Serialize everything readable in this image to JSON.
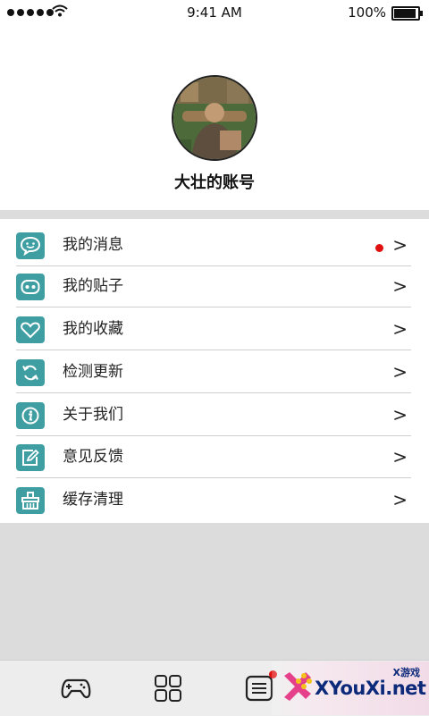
{
  "status_bar": {
    "time": "9:41 AM",
    "battery": "100%",
    "battery_level": 1.0
  },
  "profile": {
    "account_name": "大壮的账号"
  },
  "menu": {
    "items": [
      {
        "label": "我的消息",
        "icon": "message-smile-icon",
        "has_badge": true
      },
      {
        "label": "我的贴子",
        "icon": "post-icon",
        "has_badge": false
      },
      {
        "label": "我的收藏",
        "icon": "heart-icon",
        "has_badge": false
      },
      {
        "label": "检测更新",
        "icon": "refresh-icon",
        "has_badge": false
      },
      {
        "label": "关于我们",
        "icon": "info-icon",
        "has_badge": false
      },
      {
        "label": "意见反馈",
        "icon": "edit-icon",
        "has_badge": false
      },
      {
        "label": "缓存清理",
        "icon": "broom-icon",
        "has_badge": false
      }
    ],
    "chevron": ">"
  },
  "tabbar": {
    "tabs": [
      {
        "icon": "gamepad-icon"
      },
      {
        "icon": "grid-icon"
      },
      {
        "icon": "list-icon",
        "has_badge": true
      }
    ]
  },
  "watermark": {
    "brand": "XYouXi.net",
    "tag": "X游戏"
  },
  "colors": {
    "accent": "#3f9ea2",
    "badge": "#e01010",
    "background": "#dcdcdc"
  }
}
